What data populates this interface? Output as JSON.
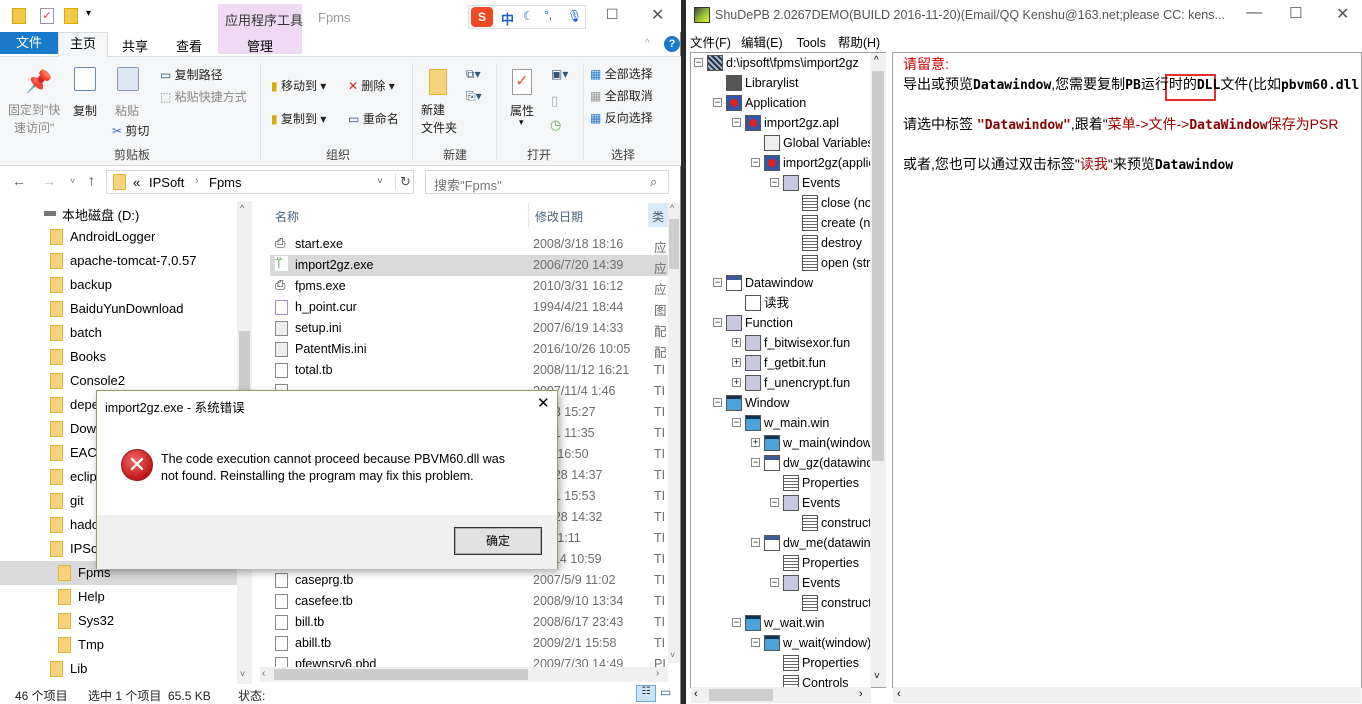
{
  "explorer": {
    "window_title": "Fpms",
    "context_tab_group": "应用程序工具",
    "tabs": [
      "文件",
      "主页",
      "共享",
      "查看",
      "管理"
    ],
    "active_tab": "主页",
    "ime": {
      "logo": "S",
      "mode": "中"
    },
    "ribbon": {
      "clipboard": {
        "pin": "固定到\"快\n速访问\"",
        "copy": "复制",
        "paste": "粘贴",
        "copy_path": "复制路径",
        "paste_shortcut": "粘贴快捷方式",
        "cut": "剪切",
        "label": "剪贴板"
      },
      "organize": {
        "move_to": "移动到",
        "delete": "删除",
        "copy_to": "复制到",
        "rename": "重命名",
        "label": "组织"
      },
      "new": {
        "new_folder": "新建\n文件夹",
        "label": "新建"
      },
      "open": {
        "properties": "属性",
        "label": "打开"
      },
      "select": {
        "select_all": "全部选择",
        "select_none": "全部取消",
        "invert": "反向选择",
        "label": "选择"
      }
    },
    "address": {
      "prefix": "«",
      "crumbs": [
        "IPSoft",
        "Fpms"
      ]
    },
    "search_placeholder": "搜索\"Fpms\"",
    "nav": [
      {
        "label": "本地磁盘 (D:)",
        "indent": 0,
        "drive": true
      },
      {
        "label": "AndroidLogger",
        "indent": 1
      },
      {
        "label": "apache-tomcat-7.0.57",
        "indent": 1
      },
      {
        "label": "backup",
        "indent": 1
      },
      {
        "label": "BaiduYunDownload",
        "indent": 1
      },
      {
        "label": "batch",
        "indent": 1
      },
      {
        "label": "Books",
        "indent": 1
      },
      {
        "label": "Console2",
        "indent": 1
      },
      {
        "label": "depe",
        "indent": 1
      },
      {
        "label": "Dow",
        "indent": 1
      },
      {
        "label": "EAC",
        "indent": 1
      },
      {
        "label": "eclip",
        "indent": 1
      },
      {
        "label": "git",
        "indent": 1
      },
      {
        "label": "hado",
        "indent": 1
      },
      {
        "label": "IPSoft",
        "indent": 1
      },
      {
        "label": "Fpms",
        "indent": 2,
        "selected": true
      },
      {
        "label": "Help",
        "indent": 2
      },
      {
        "label": "Sys32",
        "indent": 2
      },
      {
        "label": "Tmp",
        "indent": 2
      },
      {
        "label": "Lib",
        "indent": 1
      }
    ],
    "columns": {
      "name": "名称",
      "date": "修改日期",
      "type": "类"
    },
    "files": [
      {
        "name": "start.exe",
        "date": "2008/3/18 18:16",
        "type": "应",
        "icon": "exe"
      },
      {
        "name": "import2gz.exe",
        "date": "2006/7/20 14:39",
        "type": "应",
        "icon": "exe-green",
        "selected": true
      },
      {
        "name": "fpms.exe",
        "date": "2010/3/31 16:12",
        "type": "应",
        "icon": "exe"
      },
      {
        "name": "h_point.cur",
        "date": "1994/4/21 18:44",
        "type": "图",
        "icon": "cursor"
      },
      {
        "name": "setup.ini",
        "date": "2007/6/19 14:33",
        "type": "配",
        "icon": "ini"
      },
      {
        "name": "PatentMis.ini",
        "date": "2016/10/26 10:05",
        "type": "配",
        "icon": "ini"
      },
      {
        "name": "total.tb",
        "date": "2008/11/12 16:21",
        "type": "TI",
        "icon": "file"
      },
      {
        "name": "",
        "date": "2007/11/4 1:46",
        "type": "TI",
        "icon": "file"
      },
      {
        "name": "",
        "date": "/12/3 15:27",
        "type": "TI",
        "icon": "file"
      },
      {
        "name": "",
        "date": "/3/31 11:35",
        "type": "TI",
        "icon": "file"
      },
      {
        "name": "",
        "date": "/3/4 16:50",
        "type": "TI",
        "icon": "file"
      },
      {
        "name": "",
        "date": "/10/28 14:37",
        "type": "TI",
        "icon": "file"
      },
      {
        "name": "",
        "date": "/5/31 15:53",
        "type": "TI",
        "icon": "file"
      },
      {
        "name": "",
        "date": "/10/28 14:32",
        "type": "TI",
        "icon": "file"
      },
      {
        "name": "",
        "date": "/8/6 1:11",
        "type": "TI",
        "icon": "file"
      },
      {
        "name": "",
        "date": "/11/14 10:59",
        "type": "TI",
        "icon": "file"
      },
      {
        "name": "caseprg.tb",
        "date": "2007/5/9 11:02",
        "type": "TI",
        "icon": "file"
      },
      {
        "name": "casefee.tb",
        "date": "2008/9/10 13:34",
        "type": "TI",
        "icon": "file"
      },
      {
        "name": "bill.tb",
        "date": "2008/6/17 23:43",
        "type": "TI",
        "icon": "file"
      },
      {
        "name": "abill.tb",
        "date": "2009/2/1 15:58",
        "type": "TI",
        "icon": "file"
      },
      {
        "name": "pfewnsrv6.pbd",
        "date": "2009/7/30 14:49",
        "type": "PI",
        "icon": "file"
      }
    ],
    "status": {
      "count": "46 个项目",
      "selected": "选中 1 个项目  65.5 KB",
      "state": "状态:"
    }
  },
  "dialog": {
    "title": "import2gz.exe - 系统错误",
    "message_line1": "The code execution cannot proceed because PBVM60.dll was",
    "message_line2": "not found. Reinstalling the program may fix this problem.",
    "ok": "确定"
  },
  "shudepb": {
    "title": "ShuDePB 2.0267DEMO(BUILD 2016-11-20)(Email/QQ Kenshu@163.net;please CC: kens...",
    "menu": [
      "文件(F)",
      "编辑(E)",
      "Tools",
      "帮助(H)"
    ],
    "tree": [
      {
        "label": "d:\\ipsoft\\fpms\\import2gz",
        "level": 0,
        "box": "-",
        "icon": "library"
      },
      {
        "label": "Librarylist",
        "level": 1,
        "icon": "building"
      },
      {
        "label": "Application",
        "level": 1,
        "box": "-",
        "icon": "app"
      },
      {
        "label": "import2gz.apl",
        "level": 2,
        "box": "-",
        "icon": "app"
      },
      {
        "label": "Global Variables",
        "level": 3,
        "icon": "gv"
      },
      {
        "label": "import2gz(application)",
        "level": 3,
        "box": "-",
        "icon": "app"
      },
      {
        "label": "Events",
        "level": 4,
        "box": "-",
        "icon": "fx"
      },
      {
        "label": "close (none)",
        "level": 5,
        "icon": "script"
      },
      {
        "label": "create (none)",
        "level": 5,
        "icon": "script"
      },
      {
        "label": "destroy",
        "level": 5,
        "icon": "script"
      },
      {
        "label": "open (string)",
        "level": 5,
        "icon": "script"
      },
      {
        "label": "Datawindow",
        "level": 1,
        "box": "-",
        "icon": "dw"
      },
      {
        "label": "读我",
        "level": 2,
        "icon": "note"
      },
      {
        "label": "Function",
        "level": 1,
        "box": "-",
        "icon": "fx"
      },
      {
        "label": "f_bitwisexor.fun",
        "level": 2,
        "box": "+",
        "icon": "fx"
      },
      {
        "label": "f_getbit.fun",
        "level": 2,
        "box": "+",
        "icon": "fx"
      },
      {
        "label": "f_unencrypt.fun",
        "level": 2,
        "box": "+",
        "icon": "fx"
      },
      {
        "label": "Window",
        "level": 1,
        "box": "-",
        "icon": "window"
      },
      {
        "label": "w_main.win",
        "level": 2,
        "box": "-",
        "icon": "window"
      },
      {
        "label": "w_main(window)",
        "level": 3,
        "box": "+",
        "icon": "window"
      },
      {
        "label": "dw_gz(datawindow)",
        "level": 3,
        "box": "-",
        "icon": "dw"
      },
      {
        "label": "Properties",
        "level": 4,
        "icon": "script"
      },
      {
        "label": "Events",
        "level": 4,
        "box": "-",
        "icon": "fx"
      },
      {
        "label": "constructor",
        "level": 5,
        "icon": "script"
      },
      {
        "label": "dw_me(datawindow)",
        "level": 3,
        "box": "-",
        "icon": "dw"
      },
      {
        "label": "Properties",
        "level": 4,
        "icon": "script"
      },
      {
        "label": "Events",
        "level": 4,
        "box": "-",
        "icon": "fx"
      },
      {
        "label": "constructor",
        "level": 5,
        "icon": "script"
      },
      {
        "label": "w_wait.win",
        "level": 2,
        "box": "-",
        "icon": "window"
      },
      {
        "label": "w_wait(window)",
        "level": 3,
        "box": "-",
        "icon": "window"
      },
      {
        "label": "Properties",
        "level": 4,
        "icon": "script"
      },
      {
        "label": "Controls",
        "level": 4,
        "icon": "script"
      }
    ],
    "text_lines": [
      [
        {
          "t": "请留意:",
          "c": "#d40000"
        }
      ],
      [
        {
          "t": "导出或预览"
        },
        {
          "t": "Datawindow",
          "m": 1
        },
        {
          "t": ",您需要复制"
        },
        {
          "t": "PB",
          "m": 1
        },
        {
          "t": "运行时"
        },
        {
          "t": "的"
        },
        {
          "t": "DLL",
          "m": 1
        },
        {
          "t": "文件(比如"
        },
        {
          "t": "pbvm60.dll",
          "m": 1
        }
      ],
      [
        {
          "t": "请选中标签 "
        },
        {
          "t": "\"Datawindow\"",
          "m": 1,
          "c": "#8b0000"
        },
        {
          "t": ",跟着\""
        },
        {
          "t": "菜单->文件->",
          "c": "#a00000"
        },
        {
          "t": "DataWindow",
          "m": 1,
          "c": "#8b0000"
        },
        {
          "t": "保存为PSR",
          "c": "#a00000"
        }
      ],
      [
        {
          "t": "或者,您也可以通过双击标签\""
        },
        {
          "t": "读我",
          "c": "#a00000"
        },
        {
          "t": "\"来预览"
        },
        {
          "t": "Datawindow",
          "m": 1
        }
      ]
    ],
    "highlight_color": "#e03030"
  }
}
